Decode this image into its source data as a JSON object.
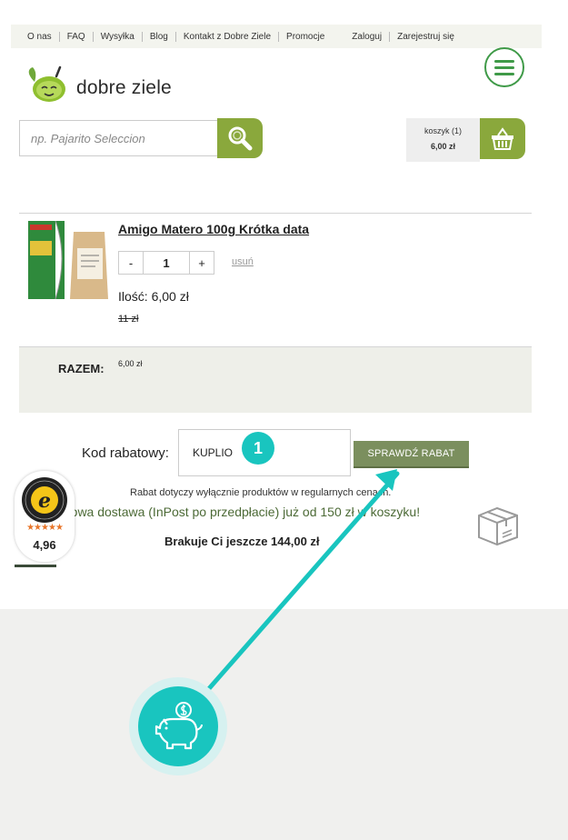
{
  "nav": {
    "items": [
      "O nas",
      "FAQ",
      "Wysyłka",
      "Blog",
      "Kontakt z Dobre Ziele",
      "Promocje"
    ],
    "login": "Zaloguj",
    "register": "Zarejestruj się"
  },
  "logo": {
    "text": "dobre ziele"
  },
  "search": {
    "placeholder": "np. Pajarito Seleccion"
  },
  "cart": {
    "label": "koszyk (1)",
    "total": "6,00 zł"
  },
  "product": {
    "title": "Amigo Matero 100g Krótka data",
    "qty_minus": "-",
    "qty": "1",
    "qty_plus": "+",
    "remove": "usuń",
    "qty_price_line": "Ilość: 6,00 zł",
    "old_price": "11 zł"
  },
  "summary": {
    "label": "RAZEM:",
    "value": "6,00 zł"
  },
  "coupon": {
    "label": "Kod rabatowy:",
    "value": "KUPLIO",
    "button": "SPRAWDŹ RABAT",
    "step": "1",
    "note": "Rabat dotyczy wyłącznie produktów w regularnych cenach.",
    "shipping": "mowa dostawa (InPost po przedpłacie)   już od 150 zł w koszyku!",
    "missing": "Brakuje Ci jeszcze 144,00 zł"
  },
  "trusted": {
    "stars": "★★★★★",
    "rating": "4,96"
  },
  "colors": {
    "accent_green": "#8aa83c",
    "button_green": "#7b8f5e",
    "teal": "#19c5bf",
    "menu_green": "#3f9a48"
  },
  "icons": [
    "hamburger-icon",
    "search-icon",
    "basket-icon",
    "box-icon",
    "piggy-bank-icon",
    "trusted-shops-seal"
  ]
}
